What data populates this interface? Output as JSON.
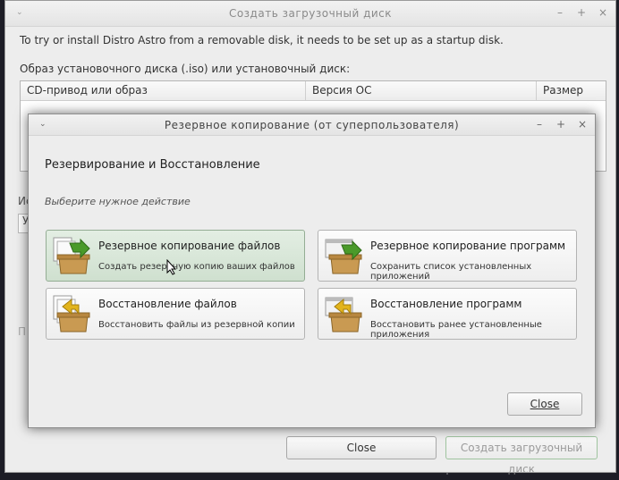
{
  "main_window": {
    "title": "Создать загрузочный диск",
    "controls": [
      "⌄",
      "–",
      "+",
      "×"
    ],
    "intro": "To try or install Distro Astro from a removable disk, it needs to be set up as a startup disk.",
    "iso_label": "Образ установочного диска (.iso) или установочный диск:",
    "columns": [
      "CD-привод или образ",
      "Версия ОС",
      "Размер"
    ],
    "peek_label_1": "Ис",
    "peek_label_2": "У",
    "peek_label_3": "П",
    "close_label": "Close",
    "create_label": "Создать загрузочный диск"
  },
  "dialog": {
    "title": "Резервное копирование (от суперпользователя)",
    "heading": "Резервирование и Восстановление",
    "subtitle": "Выберите нужное действие",
    "actions": [
      {
        "title": "Резервное копирование файлов",
        "desc": "Создать резервную копию ваших файлов",
        "icon": "backup-files-icon"
      },
      {
        "title": "Резервное копирование программ",
        "desc": "Сохранить список установленных приложений",
        "icon": "backup-apps-icon"
      },
      {
        "title": "Восстановление файлов",
        "desc": "Восстановить файлы из резервной копии",
        "icon": "restore-files-icon"
      },
      {
        "title": "Восстановление программ",
        "desc": "Восстановить ранее установленные приложения",
        "icon": "restore-apps-icon"
      }
    ],
    "close_label": "Close"
  },
  "colors": {
    "hover_green": "#cfe0cf",
    "arrow_green": "#4a9a2a",
    "arrow_yellow": "#e2b41c",
    "box_brown": "#c99a52"
  }
}
